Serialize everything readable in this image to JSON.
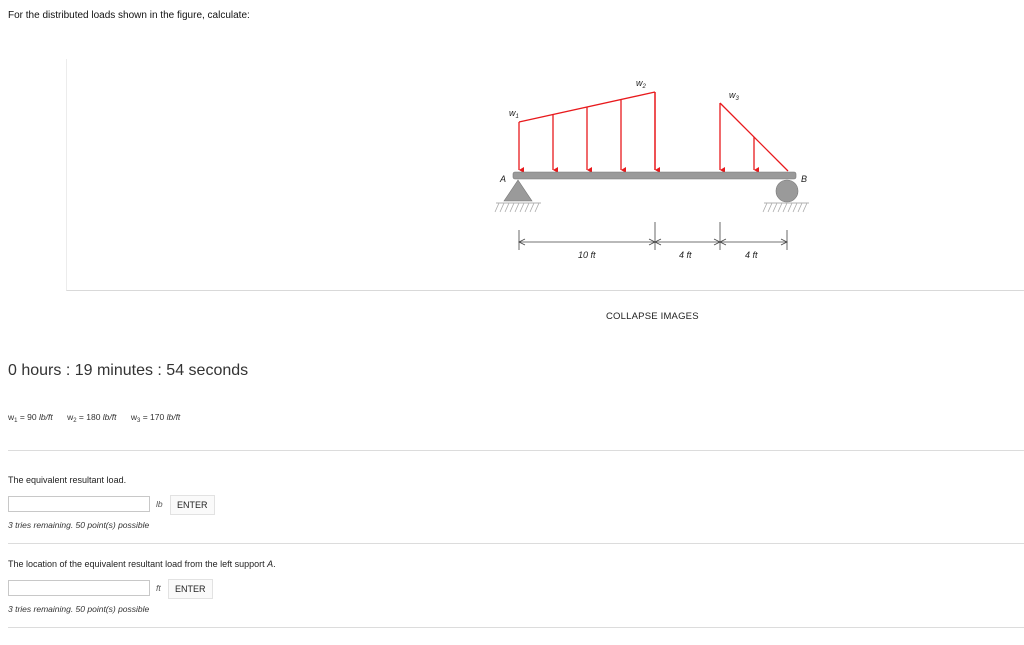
{
  "problem": {
    "prompt": "For the distributed loads shown in the figure, calculate:"
  },
  "figure": {
    "load_labels": {
      "w1": "w",
      "w1_sub": "1",
      "w2": "w",
      "w2_sub": "2",
      "w3": "w",
      "w3_sub": "3"
    },
    "support_labels": {
      "a": "A",
      "b": "B"
    },
    "dimensions": [
      "10 ft",
      "4 ft",
      "4 ft"
    ],
    "load_color": "#e8191c",
    "beam_color": "#9a9a9a"
  },
  "collapse_images_label": "COLLAPSE IMAGES",
  "timer": "0 hours : 19 minutes : 54 seconds",
  "given": {
    "w1_label": "w",
    "w1_sub": "1",
    "w1_value": " = 90 ",
    "w1_unit": "lb/ft",
    "w2_label": "w",
    "w2_sub": "2",
    "w2_value": " = 180 ",
    "w2_unit": "lb/ft",
    "w3_label": "w",
    "w3_sub": "3",
    "w3_value": " = 170 ",
    "w3_unit": "lb/ft"
  },
  "questions": [
    {
      "text": "The equivalent resultant load.",
      "input_value": "",
      "unit": "lb",
      "enter_label": "ENTER",
      "tries": "3 tries remaining. 50 point(s) possible"
    },
    {
      "text_prefix": "The location of the equivalent resultant load from the left support ",
      "text_emph": "A",
      "text_suffix": ".",
      "input_value": "",
      "unit": "ft",
      "enter_label": "ENTER",
      "tries": "3 tries remaining. 50 point(s) possible"
    }
  ]
}
